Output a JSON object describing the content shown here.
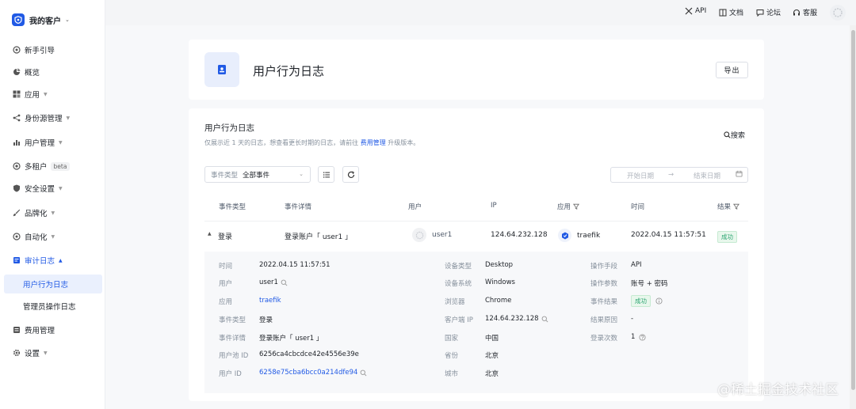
{
  "brand": {
    "name": "我的客户"
  },
  "sidebar": {
    "items": [
      {
        "label": "新手引导"
      },
      {
        "label": "概览"
      },
      {
        "label": "应用"
      },
      {
        "label": "身份源管理"
      },
      {
        "label": "用户管理"
      },
      {
        "label": "多租户",
        "badge": "beta"
      },
      {
        "label": "安全设置"
      },
      {
        "label": "品牌化"
      },
      {
        "label": "自动化"
      },
      {
        "label": "审计日志"
      },
      {
        "label": "费用管理"
      },
      {
        "label": "设置"
      }
    ],
    "sub_items": [
      {
        "label": "用户行为日志"
      },
      {
        "label": "管理员操作日志"
      }
    ]
  },
  "topbar": {
    "api": "API",
    "docs": "文档",
    "forum": "论坛",
    "support": "客服"
  },
  "header": {
    "title": "用户行为日志",
    "export": "导出"
  },
  "log": {
    "title": "用户行为日志",
    "desc_prefix": "仅展示近 1 天的日志，想查看更长时期的日志，请前往",
    "desc_link": "费用管理",
    "desc_suffix": "升级版本。",
    "search": "搜索"
  },
  "filters": {
    "event_type_label": "事件类型",
    "event_type_value": "全部事件",
    "start_date": "开始日期",
    "arrow": "→",
    "end_date": "结束日期"
  },
  "table": {
    "columns": [
      "事件类型",
      "事件详情",
      "用户",
      "IP",
      "应用",
      "时间",
      "结果"
    ],
    "row": {
      "event_type": "登录",
      "event_detail": "登录账户「 user1 」",
      "user": "user1",
      "ip": "124.64.232.128",
      "app": "traefik",
      "time": "2022.04.15 11:57:51",
      "result": "成功"
    }
  },
  "detail": {
    "col1": [
      {
        "label": "时间",
        "value": "2022.04.15 11:57:51"
      },
      {
        "label": "用户",
        "value": "user1"
      },
      {
        "label": "应用",
        "value": "traefik"
      },
      {
        "label": "事件类型",
        "value": "登录"
      },
      {
        "label": "事件详情",
        "value": "登录账户「 user1 」"
      },
      {
        "label": "用户池 ID",
        "value": "6256ca4cbcdce42e4556e39e"
      },
      {
        "label": "用户 ID",
        "value": "6258e75cba6bcc0a214dfe94"
      }
    ],
    "col2": [
      {
        "label": "设备类型",
        "value": "Desktop"
      },
      {
        "label": "设备系统",
        "value": "Windows"
      },
      {
        "label": "浏览器",
        "value": "Chrome"
      },
      {
        "label": "客户端 IP",
        "value": "124.64.232.128"
      },
      {
        "label": "国家",
        "value": "中国"
      },
      {
        "label": "省份",
        "value": "北京"
      },
      {
        "label": "城市",
        "value": "北京"
      }
    ],
    "col3": [
      {
        "label": "操作手段",
        "value": "API"
      },
      {
        "label": "操作参数",
        "value": "账号 + 密码"
      },
      {
        "label": "事件结果",
        "value": "成功"
      },
      {
        "label": "结果原因",
        "value": "-"
      },
      {
        "label": "登录次数",
        "value": "1"
      }
    ]
  },
  "watermark": "@稀土掘金技术社区"
}
